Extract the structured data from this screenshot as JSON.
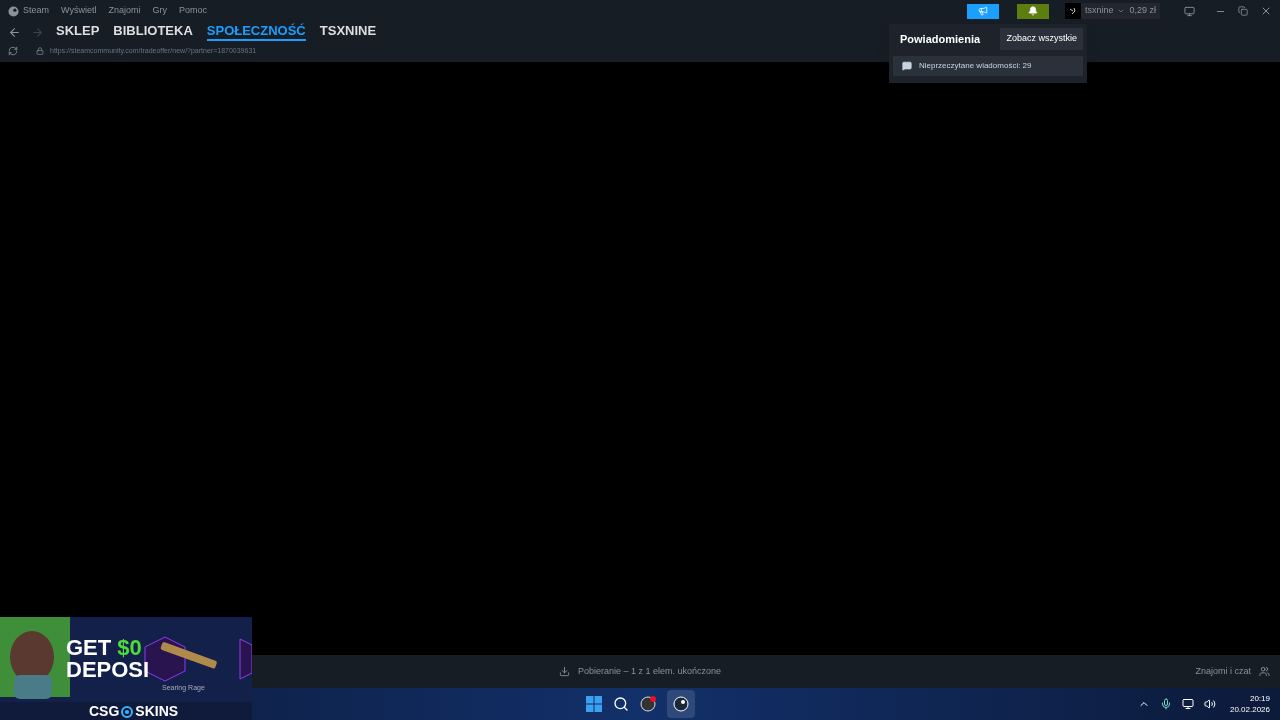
{
  "menu": [
    "Steam",
    "Wyświetl",
    "Znajomi",
    "Gry",
    "Pomoc"
  ],
  "nav": [
    {
      "label": "SKLEP",
      "selected": false
    },
    {
      "label": "BIBLIOTEKA",
      "selected": false
    },
    {
      "label": "SPOŁECZNOŚĆ",
      "selected": true
    },
    {
      "label": "TSXNINE",
      "selected": false
    }
  ],
  "url": "https://steamcommunity.com/tradeoffer/new/?partner=1870039631",
  "account": {
    "name": "tsxnine",
    "balance": "0,29 zł"
  },
  "notifications": {
    "title": "Powiadomienia",
    "see_all": "Zobacz wszystkie",
    "items": [
      "Nieprzeczytane wiadomości: 29"
    ]
  },
  "status": {
    "download": "Pobieranie – 1 z 1 elem. ukończone",
    "friends": "Znajomi i czat"
  },
  "ad": {
    "get": "GET",
    "amount": "$0",
    "deposit": "DEPOSI",
    "item": "Searing Rage",
    "brand_left": "CSG",
    "brand_right": "SKINS"
  },
  "clock": {
    "time": "20:19",
    "date": "20.02.2026"
  }
}
